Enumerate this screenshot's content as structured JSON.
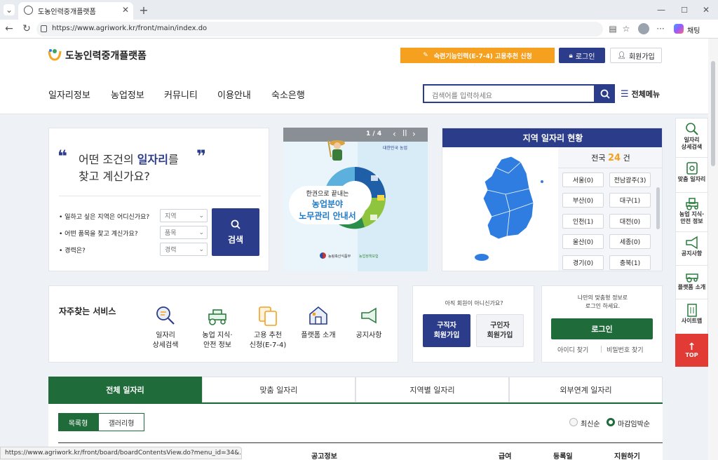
{
  "browser": {
    "tab_title": "도농인력중개플랫폼",
    "url": "https://www.agriwork.kr/front/main/index.do",
    "profile_label": "채팅",
    "status_url": "https://www.agriwork.kr/front/board/boardContentsView.do?menu_id=34&..."
  },
  "site": {
    "logo_text": "도농인력중개플랫폼",
    "e74_button": "숙련기능인력(E-7-4) 고용추천 신청",
    "login_button": "로그인",
    "signup_button": "회원가입",
    "nav": [
      "일자리정보",
      "농업정보",
      "커뮤니티",
      "이용안내",
      "숙소은행"
    ],
    "search_placeholder": "검색어를 입력하세요",
    "allmenu": "전체메뉴"
  },
  "search_card": {
    "heading_prefix": "어떤 조건의 ",
    "heading_highlight": "일자리",
    "heading_suffix": "를",
    "heading_line2": "찾고 계신가요?",
    "rows": [
      {
        "label": "일하고 싶은 지역은 어디신가요?",
        "select": "지역"
      },
      {
        "label": "어떤 품목을 찾고 계신가요?",
        "select": "품목"
      },
      {
        "label": "경력은?",
        "select": "경력"
      }
    ],
    "search_button": "검색"
  },
  "banner": {
    "counter": "1 / 4",
    "line1": "한권으로 끝내는",
    "line2": "농업분야",
    "line3": "노무관리 안내서",
    "org_top": "대한민국 농업",
    "org_left": "농림축산식품부",
    "org_right": "농업정책보험"
  },
  "region_jobs": {
    "title": "지역 일자리 현황",
    "total_prefix": "전국",
    "total_count": "24",
    "total_suffix": "건",
    "regions": [
      [
        "서울(0)",
        "전남광주(3)"
      ],
      [
        "부산(0)",
        "대구(1)"
      ],
      [
        "인천(1)",
        "대전(0)"
      ],
      [
        "울산(0)",
        "세종(0)"
      ],
      [
        "경기(0)",
        "충북(1)"
      ]
    ]
  },
  "services": {
    "title": "자주찾는 서비스",
    "items": [
      {
        "label": "일자리\n상세검색",
        "icon": "magnifier-doc-icon"
      },
      {
        "label": "농업 지식·\n안전 정보",
        "icon": "tractor-icon"
      },
      {
        "label": "고용 추천\n신청(E-7-4)",
        "icon": "doc-copy-icon"
      },
      {
        "label": "플랫폼 소개",
        "icon": "farmhouse-icon"
      },
      {
        "label": "공지사항",
        "icon": "megaphone-icon"
      }
    ]
  },
  "member": {
    "question": "아직 회원이 아니신가요?",
    "seeker_button": "구직자\n회원가입",
    "employer_button": "구인자\n회원가입"
  },
  "login_card": {
    "text": "나만의 맞춤형 정보로\n로그인 하세요.",
    "button": "로그인",
    "find_id": "아이디 찾기",
    "find_pw": "비밀번호 찾기"
  },
  "job_tabs": [
    "전체 일자리",
    "맞춤 일자리",
    "지역별 일자리",
    "외부연계 일자리"
  ],
  "view_toggle": [
    "목록형",
    "갤러리형"
  ],
  "sort": [
    "최신순",
    "마감임박순"
  ],
  "table_headers": [
    "공고정보",
    "급여",
    "등록일",
    "지원하기"
  ],
  "quick_menu": [
    {
      "label": "일자리\n상세검색",
      "icon": "search-doc-icon"
    },
    {
      "label": "맞춤 일자리",
      "icon": "target-doc-icon"
    },
    {
      "label": "농업 지식·\n안전 정보",
      "icon": "tractor-icon"
    },
    {
      "label": "공지사항",
      "icon": "megaphone-icon"
    },
    {
      "label": "플랫폼 소개",
      "icon": "tractor2-icon"
    },
    {
      "label": "사이트맵",
      "icon": "building-icon"
    }
  ],
  "top_button": "TOP",
  "colors": {
    "navy": "#2b3c8a",
    "orange": "#f5a623",
    "green": "#1f6b3a",
    "red": "#e23a35",
    "blue_map": "#2f7de1"
  }
}
